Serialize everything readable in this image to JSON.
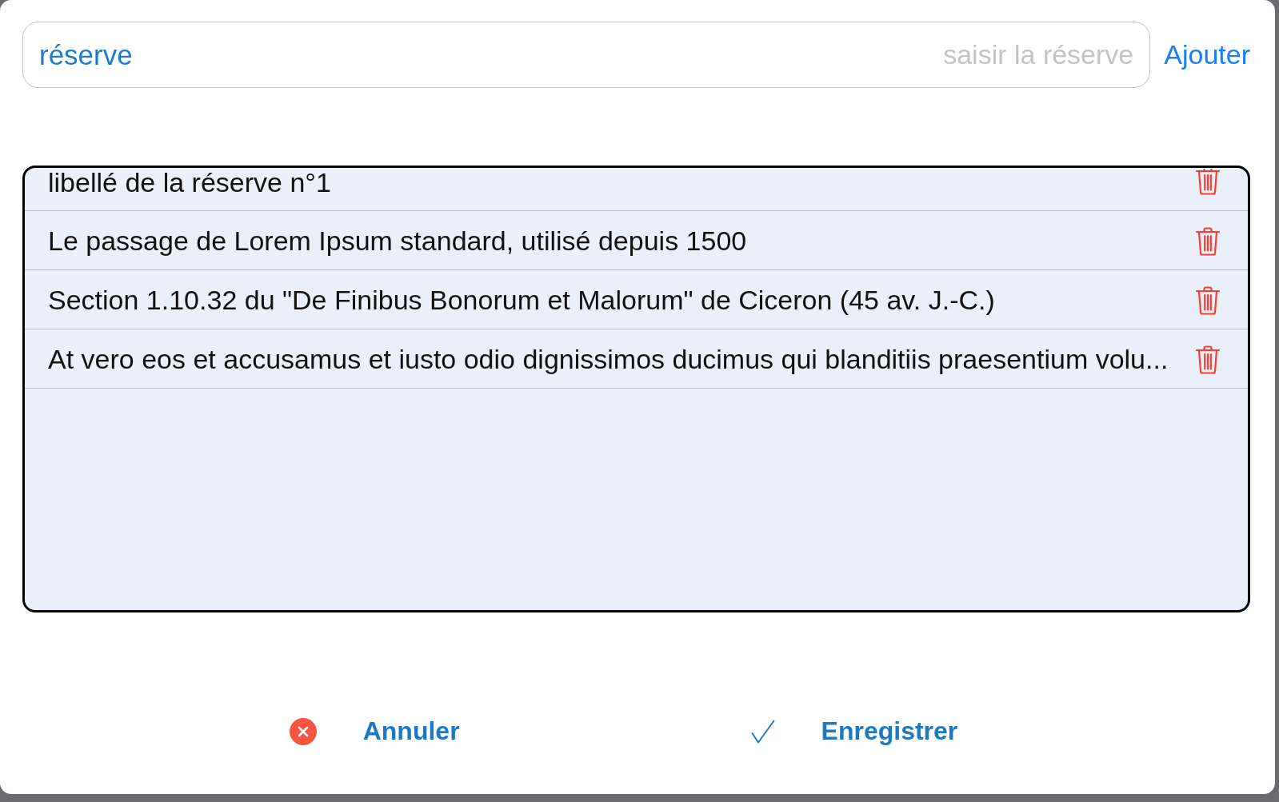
{
  "entry": {
    "label": "réserve",
    "placeholder": "saisir la réserve"
  },
  "add_button": {
    "label": "Ajouter"
  },
  "reserves": [
    {
      "label": "libellé de la réserve n°1"
    },
    {
      "label": "Le passage de Lorem Ipsum standard, utilisé depuis 1500"
    },
    {
      "label": "Section 1.10.32 du \"De Finibus Bonorum et Malorum\" de Ciceron (45 av. J.-C.)"
    },
    {
      "label": "At vero eos et accusamus et iusto odio dignissimos ducimus qui blanditiis praesentium volu..."
    }
  ],
  "buttons": [
    {
      "kind": "cancel",
      "label": "Annuler"
    },
    {
      "kind": "save",
      "label": "Enregistrer"
    }
  ]
}
